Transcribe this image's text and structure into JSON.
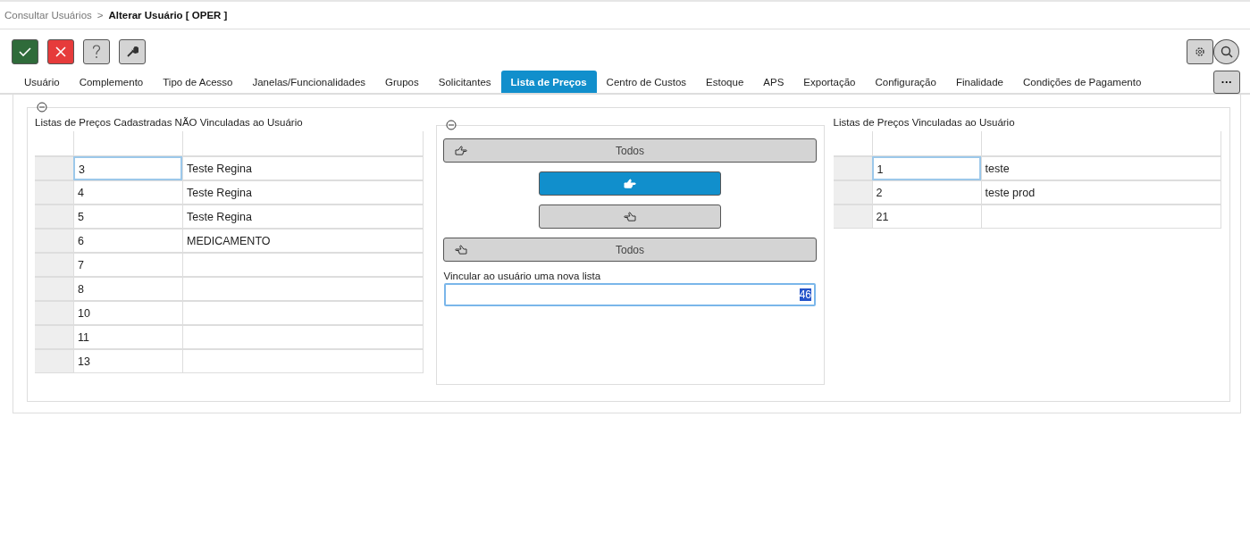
{
  "breadcrumb": {
    "parent": "Consultar Usuários",
    "separator": ">",
    "current": "Alterar Usuário [ OPER ]"
  },
  "toolbar": [
    {
      "kind": "confirm"
    },
    {
      "kind": "cancel"
    },
    {
      "kind": "help"
    },
    {
      "kind": "tools"
    }
  ],
  "tabs": [
    {
      "label": "Usuário",
      "selected": false
    },
    {
      "label": "Complemento",
      "selected": false
    },
    {
      "label": "Tipo de Acesso",
      "selected": false
    },
    {
      "label": "Janelas/Funcionalidades",
      "selected": false
    },
    {
      "label": "Grupos",
      "selected": false
    },
    {
      "label": "Solicitantes",
      "selected": false
    },
    {
      "label": "Lista de Preços",
      "selected": true
    },
    {
      "label": "Centro de Custos",
      "selected": false
    },
    {
      "label": "Estoque",
      "selected": false
    },
    {
      "label": "APS",
      "selected": false
    },
    {
      "label": "Exportação",
      "selected": false
    },
    {
      "label": "Configuração",
      "selected": false
    },
    {
      "label": "Finalidade",
      "selected": false
    },
    {
      "label": "Condições de Pagamento",
      "selected": false
    }
  ],
  "more_button": {
    "label": "···"
  },
  "unlinked": {
    "title": "Listas de Preços Cadastradas NÃO Vinculadas ao Usuário",
    "rows": [
      {
        "code": "3",
        "name": "Teste Regina",
        "selected": true
      },
      {
        "code": "4",
        "name": "Teste Regina",
        "selected": false
      },
      {
        "code": "5",
        "name": "Teste Regina",
        "selected": false
      },
      {
        "code": "6",
        "name": "MEDICAMENTO",
        "selected": false
      },
      {
        "code": "7",
        "name": "",
        "selected": false
      },
      {
        "code": "8",
        "name": "",
        "selected": false
      },
      {
        "code": "10",
        "name": "",
        "selected": false
      },
      {
        "code": "11",
        "name": "",
        "selected": false
      },
      {
        "code": "13",
        "name": "",
        "selected": false
      }
    ]
  },
  "transfer_buttons": [
    {
      "kind": "all-right",
      "label": "Todos",
      "highlighted": false
    },
    {
      "kind": "right",
      "highlighted": true
    },
    {
      "kind": "left",
      "highlighted": false
    },
    {
      "kind": "all-left",
      "label": "Todos",
      "highlighted": false
    }
  ],
  "new_list": {
    "label": "Vincular ao usuário uma nova lista",
    "value": "46",
    "value_selected": true
  },
  "linked": {
    "title": "Listas de Preços Vinculadas ao Usuário",
    "rows": [
      {
        "code": "1",
        "name": "teste",
        "selected": true
      },
      {
        "code": "2",
        "name": "teste prod",
        "selected": false
      },
      {
        "code": "21",
        "name": "",
        "selected": false
      }
    ]
  }
}
